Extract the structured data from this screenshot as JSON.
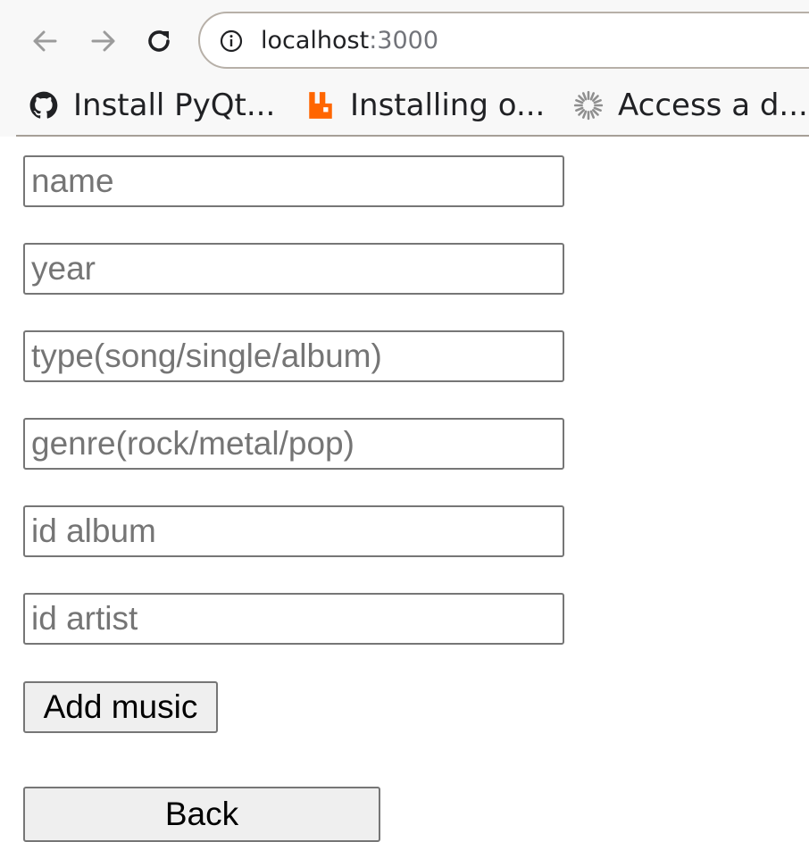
{
  "browser": {
    "url_host": "localhost",
    "url_port": ":3000",
    "bookmarks": [
      {
        "label": "Install PyQt...",
        "icon": "github-icon"
      },
      {
        "label": "Installing o...",
        "icon": "rabbitmq-icon"
      },
      {
        "label": "Access a d...",
        "icon": "spinner-icon"
      }
    ]
  },
  "form": {
    "fields": [
      {
        "placeholder": "name",
        "value": ""
      },
      {
        "placeholder": "year",
        "value": ""
      },
      {
        "placeholder": "type(song/single/album)",
        "value": ""
      },
      {
        "placeholder": "genre(rock/metal/pop)",
        "value": ""
      },
      {
        "placeholder": "id album",
        "value": ""
      },
      {
        "placeholder": "id artist",
        "value": ""
      }
    ],
    "submit_label": "Add music",
    "back_label": "Back"
  },
  "colors": {
    "rabbitmq_orange": "#ff6600",
    "chrome_background": "#f8f8f8",
    "button_background": "#efefef"
  }
}
